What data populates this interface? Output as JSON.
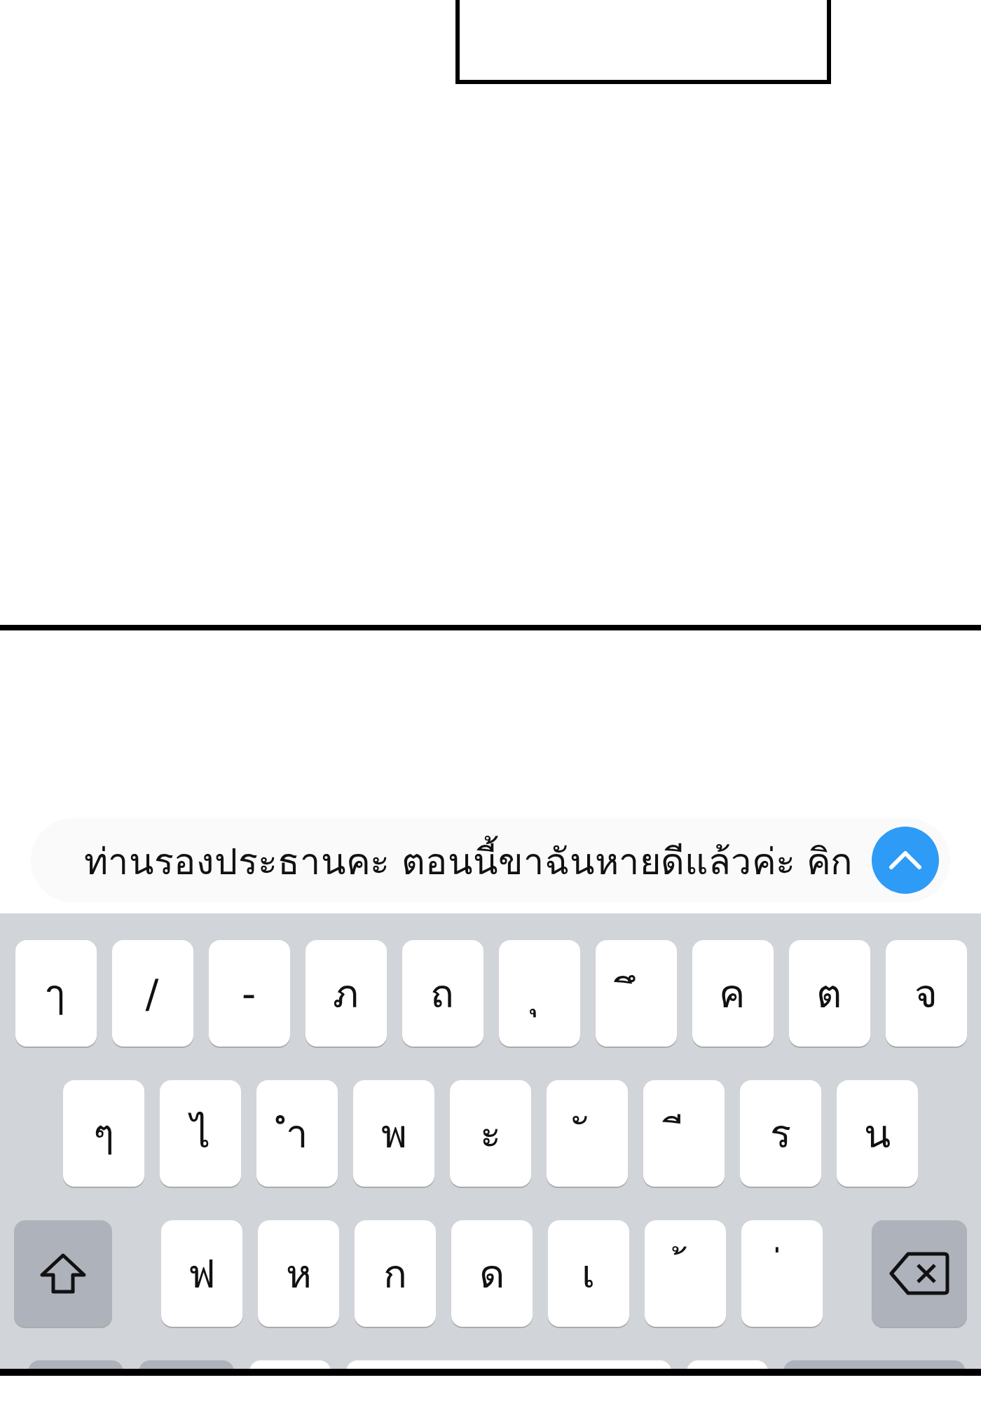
{
  "message_field": {
    "value": "ท่านรองประธานคะ ตอนนี้ขาฉันหายดีแล้วค่ะ คิก"
  },
  "keyboard": {
    "rows": [
      {
        "keys": [
          {
            "kind": "char",
            "label": "ๅ"
          },
          {
            "kind": "char",
            "label": "/"
          },
          {
            "kind": "char",
            "label": "-"
          },
          {
            "kind": "char",
            "label": "ภ"
          },
          {
            "kind": "char",
            "label": "ถ"
          },
          {
            "kind": "char",
            "label": "ุ"
          },
          {
            "kind": "char",
            "label": "ึ"
          },
          {
            "kind": "char",
            "label": "ค"
          },
          {
            "kind": "char",
            "label": "ต"
          },
          {
            "kind": "char",
            "label": "จ"
          }
        ]
      },
      {
        "keys": [
          {
            "kind": "char",
            "label": "ๆ"
          },
          {
            "kind": "char",
            "label": "ไ"
          },
          {
            "kind": "char",
            "label": "ำ"
          },
          {
            "kind": "char",
            "label": "พ"
          },
          {
            "kind": "char",
            "label": "ะ"
          },
          {
            "kind": "char",
            "label": "ั"
          },
          {
            "kind": "char",
            "label": "ี"
          },
          {
            "kind": "char",
            "label": "ร"
          },
          {
            "kind": "char",
            "label": "น"
          }
        ]
      },
      {
        "keys": [
          {
            "kind": "shift"
          },
          {
            "kind": "char",
            "label": "ฟ"
          },
          {
            "kind": "char",
            "label": "ห"
          },
          {
            "kind": "char",
            "label": "ก"
          },
          {
            "kind": "char",
            "label": "ด"
          },
          {
            "kind": "char",
            "label": "เ"
          },
          {
            "kind": "char",
            "label": "้"
          },
          {
            "kind": "char",
            "label": "่"
          },
          {
            "kind": "delete"
          }
        ]
      },
      {
        "keys": [
          {
            "kind": "function"
          },
          {
            "kind": "function"
          },
          {
            "kind": "blank"
          },
          {
            "kind": "space"
          },
          {
            "kind": "blank"
          },
          {
            "kind": "return"
          }
        ]
      }
    ]
  }
}
